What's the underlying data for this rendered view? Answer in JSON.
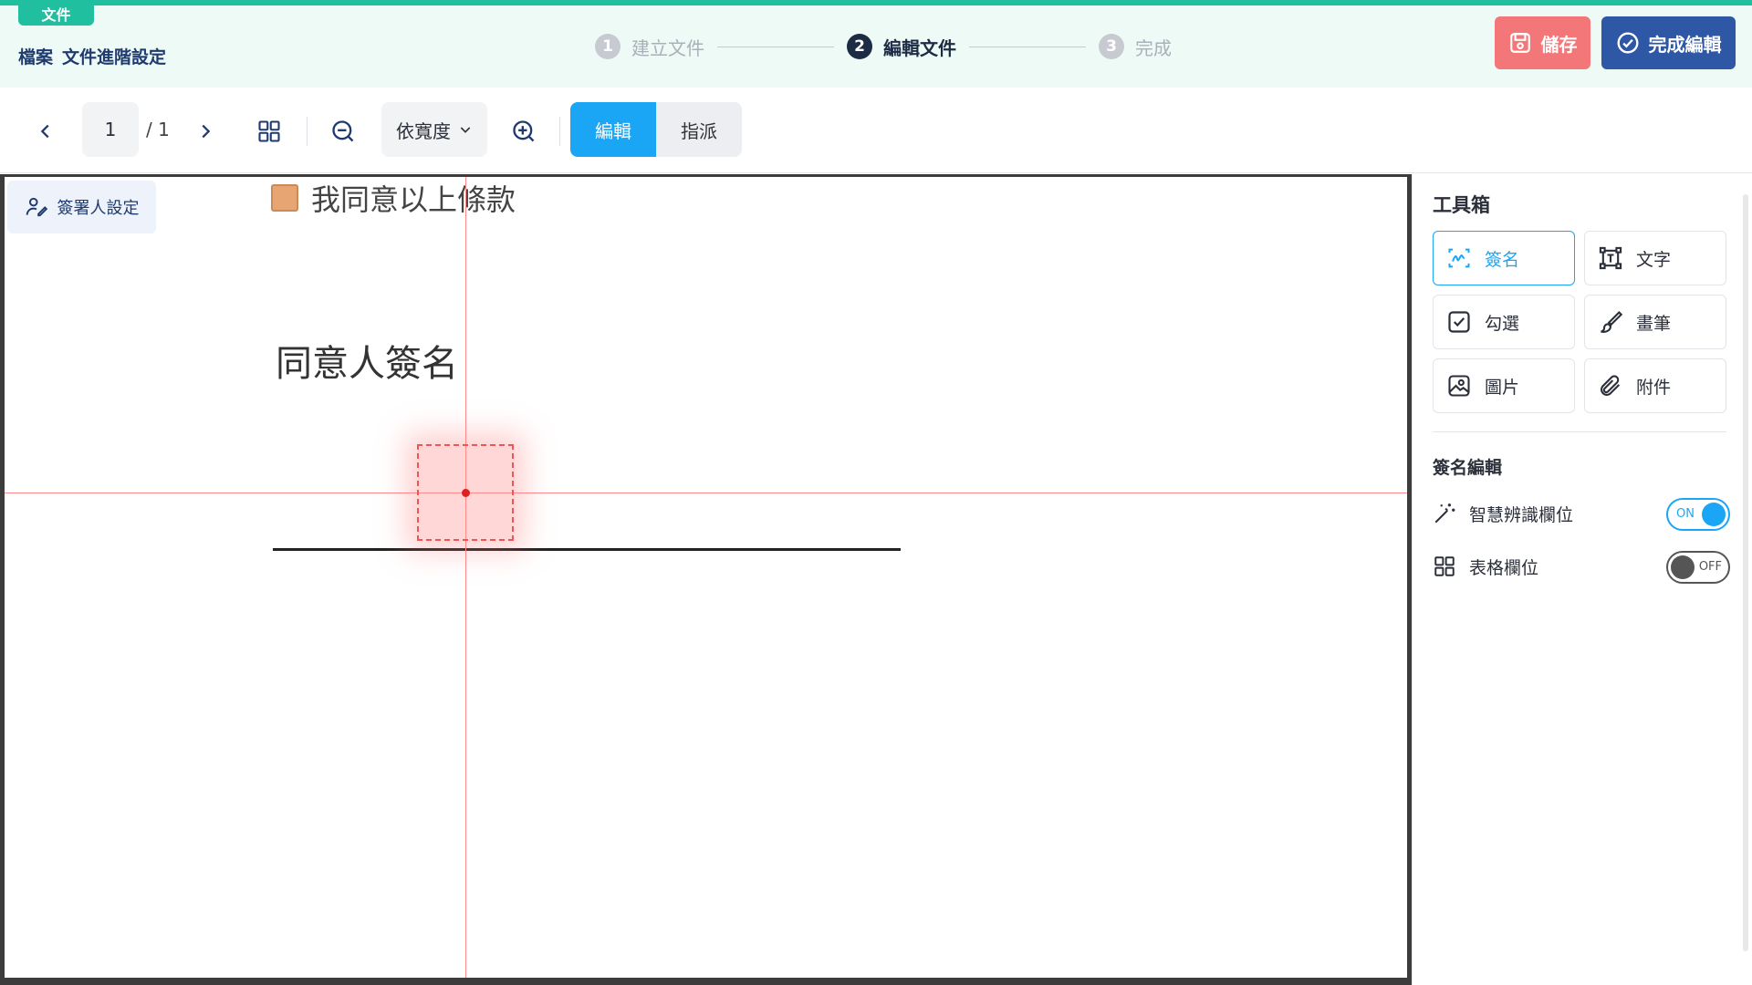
{
  "header": {
    "tag": "文件",
    "breadcrumb": [
      "檔案",
      "文件進階設定"
    ],
    "steps": [
      {
        "num": "1",
        "label": "建立文件"
      },
      {
        "num": "2",
        "label": "編輯文件"
      },
      {
        "num": "3",
        "label": "完成"
      }
    ],
    "active_step": 2,
    "save_label": "儲存",
    "done_label": "完成編輯"
  },
  "toolbar": {
    "current_page": "1",
    "total_pages": "/ 1",
    "zoom_mode": "依寬度",
    "modes": [
      "編輯",
      "指派"
    ],
    "active_mode": "編輯"
  },
  "canvas": {
    "signer_settings": "簽署人設定",
    "agree_text": "我同意以上條款",
    "sig_title": "同意人簽名"
  },
  "panel": {
    "title": "工具箱",
    "tools": [
      {
        "label": "簽名",
        "icon": "signature-icon"
      },
      {
        "label": "文字",
        "icon": "text-box-icon"
      },
      {
        "label": "勾選",
        "icon": "checkbox-icon"
      },
      {
        "label": "畫筆",
        "icon": "brush-icon"
      },
      {
        "label": "圖片",
        "icon": "image-icon"
      },
      {
        "label": "附件",
        "icon": "paperclip-icon"
      }
    ],
    "active_tool": "簽名",
    "sub_title": "簽名編輯",
    "options": [
      {
        "label": "智慧辨識欄位",
        "state": "ON"
      },
      {
        "label": "表格欄位",
        "state": "OFF"
      }
    ]
  },
  "colors": {
    "brand_green": "#1fbf9f",
    "accent_blue": "#1aa6f5",
    "save_red": "#f37778",
    "done_navy": "#2e57a6"
  }
}
